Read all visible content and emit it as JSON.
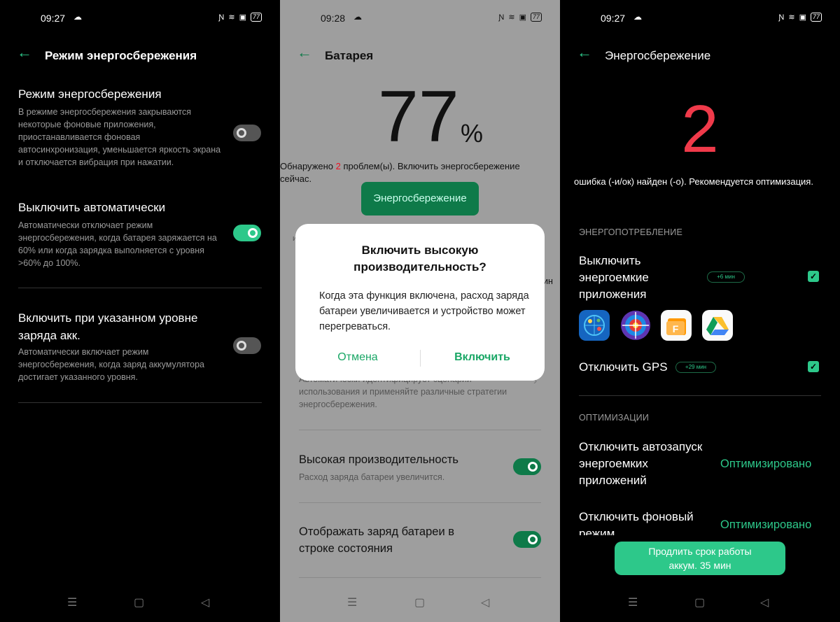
{
  "statusbar": [
    {
      "time": "09:27",
      "battery": "77"
    },
    {
      "time": "09:28",
      "battery": "77"
    },
    {
      "time": "09:27",
      "battery": "77"
    }
  ],
  "panel1": {
    "title": "Режим энергосбережения",
    "items": [
      {
        "title": "Режим энергосбережения",
        "desc": "В режиме энергосбережения закрываются некоторые фоновые приложения, приостанавливается фоновая автосинхронизация, уменьшается яркость экрана и отключается вибрация при нажатии.",
        "on": false
      },
      {
        "title": "Выключить автоматически",
        "desc": "Автоматически отключает режим энергосбережения, когда батарея заряжается на 60% или когда зарядка выполняется с уровня >60% до 100%.",
        "on": true
      },
      {
        "title": "Включить при указанном уровне заряда акк.",
        "desc": "Автоматически включает режим энергосбережения, когда заряд аккумулятора достигает указанного уровня.",
        "on": false
      }
    ]
  },
  "panel2": {
    "title": "Батарея",
    "percent": "77",
    "percent_sign": "%",
    "problem_prefix": "Обнаружено ",
    "problem_count": "2",
    "problem_suffix": " проблем(ы). Включить энергосбережение сейчас.",
    "save_button": "Энергосбережение",
    "dialog": {
      "title": "Включить высокую производительность?",
      "body": "Когда эта функция включена, расход заряда батареи увеличивается и устройство может перегреваться.",
      "cancel": "Отмена",
      "confirm": "Включить"
    },
    "peek_left": "и",
    "peek_right": "ин",
    "smart_desc": "Автоматически идентифицирует сценарии использования и применяйте различные стратегии энергосбережения.",
    "items": [
      {
        "title": "Высокая производительность",
        "desc": "Расход заряда батареи увеличится.",
        "on": true
      },
      {
        "title": "Отображать заряд батареи в строке состояния",
        "desc": "",
        "on": true
      }
    ]
  },
  "panel3": {
    "title": "Энергосбережение",
    "count": "2",
    "recommendation": "ошибка (-и/ок) найден (-о). Рекомендуется оптимизация.",
    "section_power": "ЭНЕРГОПОТРЕБЛЕНИЕ",
    "item_apps": {
      "title": "Выключить энергоемкие приложения",
      "badge": "+6 мин",
      "checked": true
    },
    "apps": [
      "compass-app",
      "radar-app",
      "file-manager-app",
      "google-drive-app"
    ],
    "item_gps": {
      "title": "Отключить GPS",
      "badge": "+29 мин",
      "checked": true
    },
    "section_opt": "ОПТИМИЗАЦИИ",
    "opt_items": [
      {
        "title": "Отключить автозапуск энергоемких приложений",
        "status": "Оптимизировано"
      },
      {
        "title": "Отключить фоновый режим",
        "status": "Оптимизировано"
      }
    ],
    "extend_button": "Продлить срок работы аккум. 35 мин"
  },
  "colors": {
    "accent": "#2dc88a",
    "accent_dark": "#0e7a49",
    "error": "#f03a4a",
    "dim_bg": "#9e9e9e"
  }
}
